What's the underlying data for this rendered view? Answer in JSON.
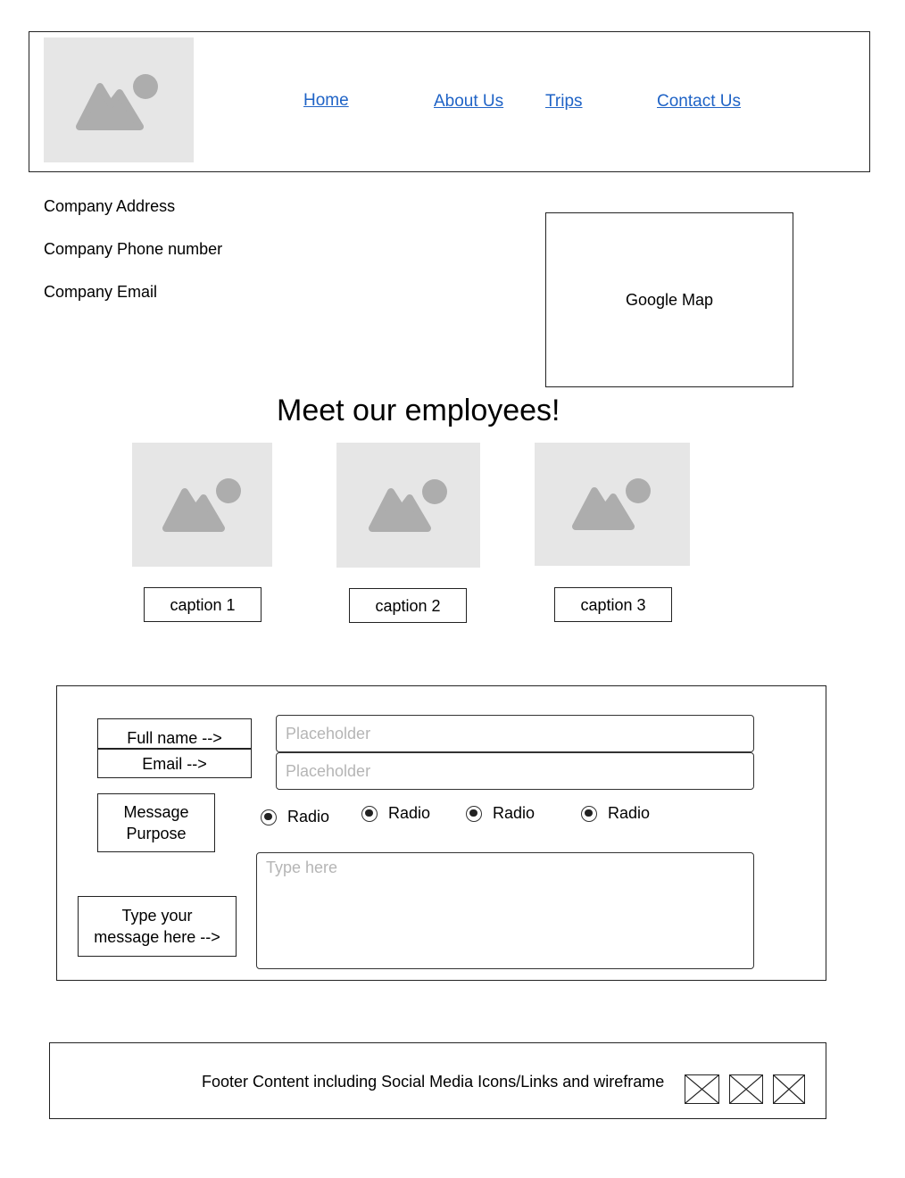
{
  "header": {
    "logo_icon": "image-placeholder-icon",
    "nav": [
      {
        "label": "Home"
      },
      {
        "label": "About Us"
      },
      {
        "label": "Trips"
      },
      {
        "label": "Contact Us"
      }
    ]
  },
  "company": {
    "address": "Company Address",
    "phone": "Company Phone number",
    "email": "Company Email"
  },
  "map": {
    "label": "Google Map"
  },
  "employees": {
    "heading": "Meet our employees!",
    "items": [
      {
        "caption": "caption 1",
        "icon": "image-placeholder-icon"
      },
      {
        "caption": "caption 2",
        "icon": "image-placeholder-icon"
      },
      {
        "caption": "caption 3",
        "icon": "image-placeholder-icon"
      }
    ]
  },
  "form": {
    "full_name_label": "Full name -->",
    "email_label": "Email -->",
    "full_name_placeholder": "Placeholder",
    "email_placeholder": "Placeholder",
    "purpose_label_line1": "Message",
    "purpose_label_line2": "Purpose",
    "radios": [
      {
        "label": "Radio",
        "selected": true
      },
      {
        "label": "Radio",
        "selected": true
      },
      {
        "label": "Radio",
        "selected": true
      },
      {
        "label": "Radio",
        "selected": true
      }
    ],
    "message_label_line1": "Type your",
    "message_label_line2": "message here -->",
    "message_placeholder": "Type here"
  },
  "footer": {
    "text": "Footer Content including Social Media Icons/Links and wireframe",
    "social_icons": [
      "social-icon-placeholder",
      "social-icon-placeholder",
      "social-icon-placeholder"
    ]
  },
  "colors": {
    "link": "#1f63c6",
    "placeholder_bg": "#e6e6e6",
    "placeholder_glyph": "#adadad",
    "placeholder_text": "#b5b5b5"
  }
}
